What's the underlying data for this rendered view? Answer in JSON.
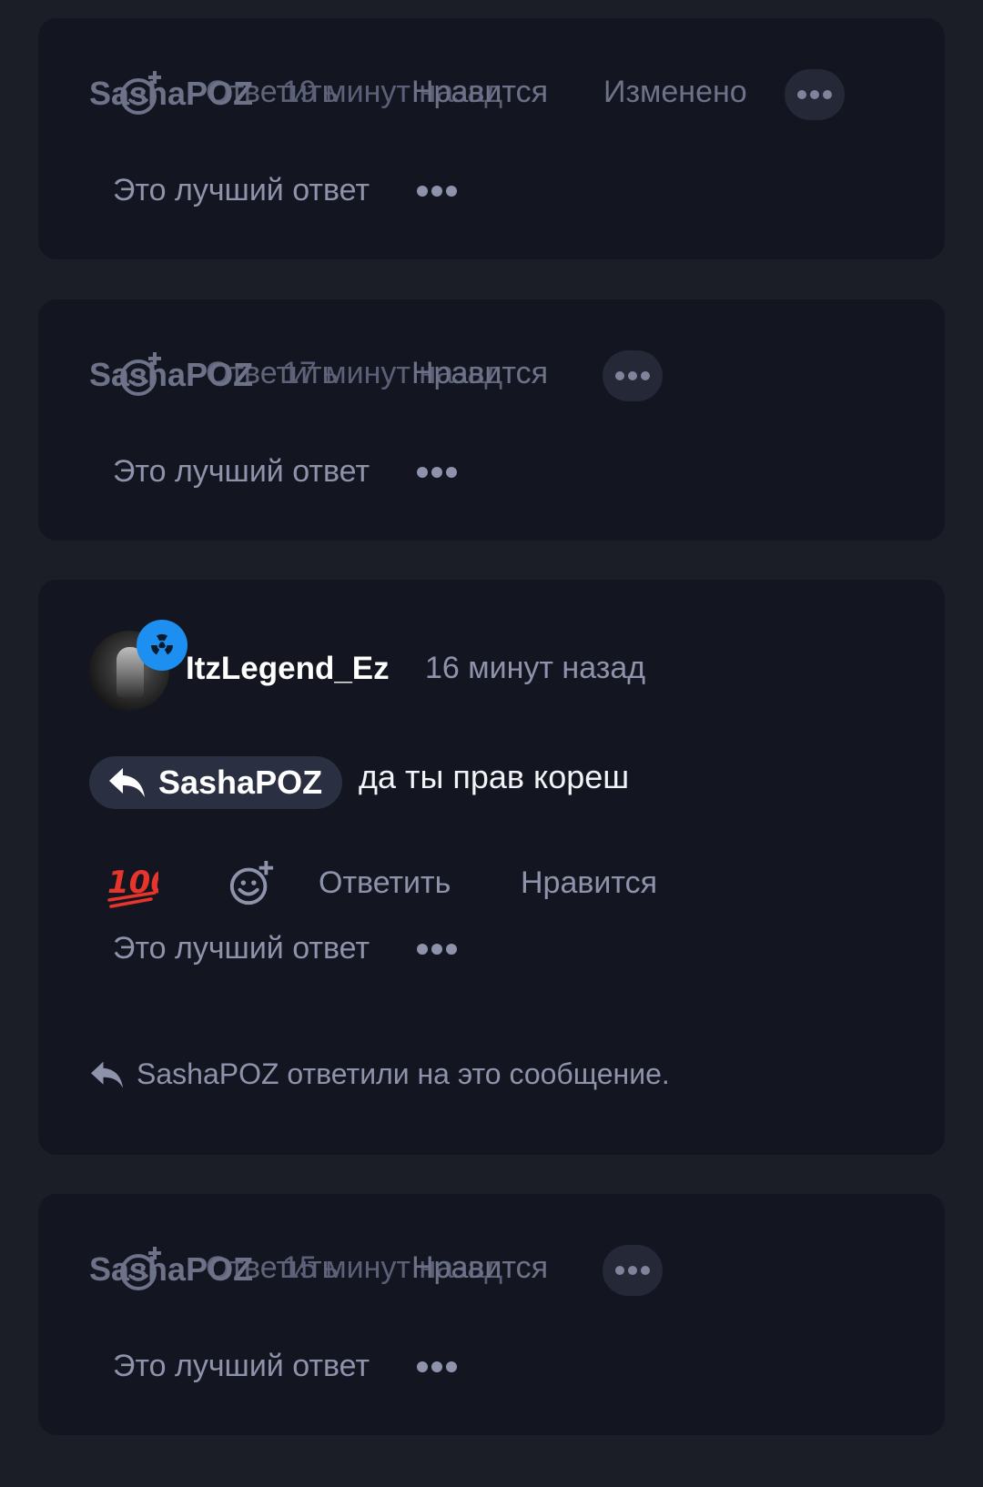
{
  "comments": [
    {
      "author": "SashaPOZ",
      "reply_label": "Ответить",
      "time": "19 минут назад",
      "like_label": "Нравится",
      "edited_label": "Изменено",
      "best_answer_label": "Это лучший ответ"
    },
    {
      "author": "SashaPOZ",
      "reply_label": "Ответить",
      "time": "17 минут назад",
      "like_label": "Нравится",
      "best_answer_label": "Это лучший ответ"
    },
    {
      "author": "ItzLegend_Ez",
      "time": "16 минут назад",
      "reply_to": "SashaPOZ",
      "message": "да ты прав кореш",
      "reaction_emoji": "💯",
      "reply_label": "Ответить",
      "like_label": "Нравится",
      "best_answer_label": "Это лучший ответ",
      "replied_note": "SashaPOZ ответили на это сообщение.",
      "badge_icon": "radioactive-icon",
      "badge_color": "#1d8ff0"
    },
    {
      "author": "SashaPOZ",
      "reply_label": "Ответить",
      "time": "15 минут назад",
      "like_label": "Нравится",
      "best_answer_label": "Это лучший ответ"
    }
  ],
  "colors": {
    "background": "#1b1d27",
    "card": "#131620",
    "muted_text": "#8e93ab",
    "chip": "#2b2f42"
  }
}
